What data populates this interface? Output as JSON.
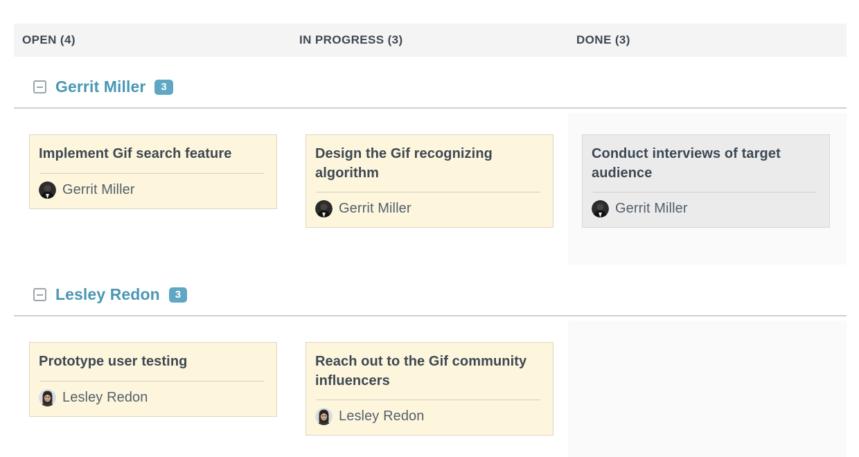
{
  "columns": [
    {
      "label": "OPEN (4)",
      "key": "open"
    },
    {
      "label": "IN PROGRESS (3)",
      "key": "in_progress"
    },
    {
      "label": "DONE (3)",
      "key": "done"
    }
  ],
  "swimlanes": [
    {
      "name": "Gerrit Miller",
      "badge": "3",
      "collapse_icon": "minus-square-icon",
      "cards": {
        "open": [
          {
            "title": "Implement Gif search feature",
            "assignee": "Gerrit Miller",
            "avatar": "gerrit-miller-avatar",
            "style": "yellow"
          }
        ],
        "in_progress": [
          {
            "title": "Design the Gif recognizing algorithm",
            "assignee": "Gerrit Miller",
            "avatar": "gerrit-miller-avatar",
            "style": "yellow"
          }
        ],
        "done": [
          {
            "title": "Conduct interviews of target audience",
            "assignee": "Gerrit Miller",
            "avatar": "gerrit-miller-avatar",
            "style": "gray"
          }
        ]
      }
    },
    {
      "name": "Lesley Redon",
      "badge": "3",
      "collapse_icon": "minus-square-icon",
      "cards": {
        "open": [
          {
            "title": "Prototype user testing",
            "assignee": "Lesley Redon",
            "avatar": "lesley-redon-avatar",
            "style": "yellow"
          }
        ],
        "in_progress": [
          {
            "title": "Reach out to the Gif community influencers",
            "assignee": "Lesley Redon",
            "avatar": "lesley-redon-avatar",
            "style": "yellow"
          }
        ],
        "done": []
      }
    }
  ],
  "colors": {
    "header_bar": "#f4f4f4",
    "header_text": "#3d4852",
    "lane_name": "#4a97b5",
    "badge_bg": "#5fa7c4",
    "card_yellow_bg": "#fdf6dd",
    "card_yellow_border": "#ded6c0",
    "card_gray_bg": "#ebebeb",
    "card_gray_border": "#d8d8d8",
    "done_column_bg": "#fafafa",
    "divider": "#cfcfcf"
  }
}
